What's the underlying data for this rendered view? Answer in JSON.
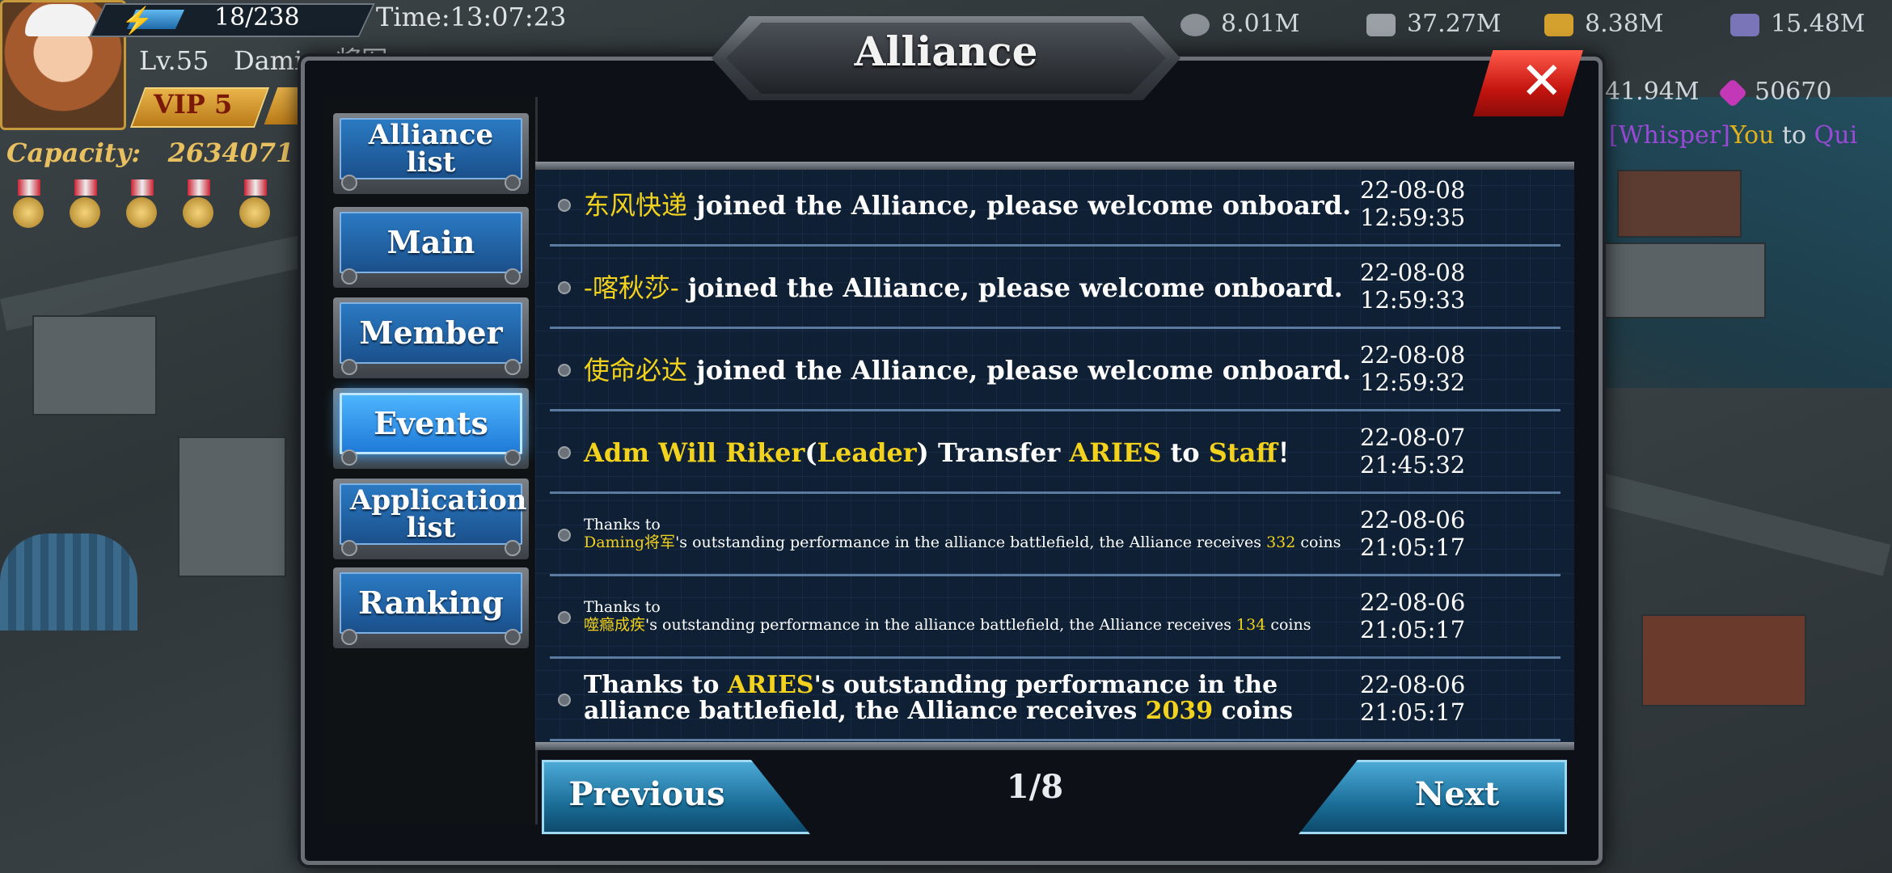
{
  "hud": {
    "energy": "18/238",
    "time": "Time:13:07:23",
    "level": "Lv.55",
    "player_name": "Daming将军",
    "vip": "VIP  5",
    "capacity_label": "Capacity:",
    "capacity_value": "2634071",
    "resources": [
      {
        "icon": "gear-icon",
        "value": "8.01M"
      },
      {
        "icon": "shell-icon",
        "value": "37.27M"
      },
      {
        "icon": "gold-ore-icon",
        "value": "8.38M"
      },
      {
        "icon": "crystal-icon",
        "value": "15.48M"
      },
      {
        "icon": "oil-icon",
        "value": "41.94M"
      },
      {
        "icon": "diamond-icon",
        "value": "50670"
      }
    ],
    "whisper": {
      "tag": "[Whisper]",
      "who": "You",
      "to": "to",
      "target": "Qui"
    }
  },
  "window": {
    "title": "Alliance",
    "close_label": "✕"
  },
  "tabs": [
    {
      "label": "Alliance list",
      "active": false
    },
    {
      "label": "Main",
      "active": false
    },
    {
      "label": "Member",
      "active": false
    },
    {
      "label": "Events",
      "active": true
    },
    {
      "label": "Application list",
      "active": false
    },
    {
      "label": "Ranking",
      "active": false
    }
  ],
  "events": [
    {
      "name": "东风快递",
      "text": " joined the Alliance, please welcome onboard.",
      "time": "22-08-08 12:59:35"
    },
    {
      "name": "-喀秋莎-",
      "text": " joined the Alliance, please welcome onboard.",
      "time": "22-08-08 12:59:33"
    },
    {
      "name": "使命必达",
      "text": " joined the Alliance, please welcome onboard.",
      "time": "22-08-08 12:59:32"
    },
    {
      "leader": "Adm Will Riker",
      "role": "Leader",
      "mid": " Transfer ",
      "target": "ARIES",
      "to": " to ",
      "rank": "Staff",
      "end": "！",
      "time": "22-08-07 21:45:32"
    },
    {
      "line1": "Thanks to",
      "name": "Daming将军",
      "text": "'s outstanding performance in the alliance battlefield, the Alliance receives ",
      "coins": "332",
      "suffix": " coins",
      "time": "22-08-06 21:05:17"
    },
    {
      "line1": "Thanks to",
      "name": "噬瘾成疾",
      "text": "'s outstanding performance in the alliance battlefield, the Alliance receives ",
      "coins": "134",
      "suffix": " coins",
      "time": "22-08-06 21:05:17"
    },
    {
      "prefix": "Thanks to ",
      "name": "ARIES",
      "text": "'s outstanding performance in the alliance battlefield, the Alliance receives ",
      "coins": "2039",
      "suffix": " coins",
      "time": "22-08-06 21:05:17"
    }
  ],
  "pagination": {
    "prev_label": "Previous",
    "page": "1/8",
    "next_label": "Next"
  },
  "colors": {
    "highlight": "#f2d21c",
    "active_tab": "#4fb7ff",
    "close": "#c4140f"
  }
}
